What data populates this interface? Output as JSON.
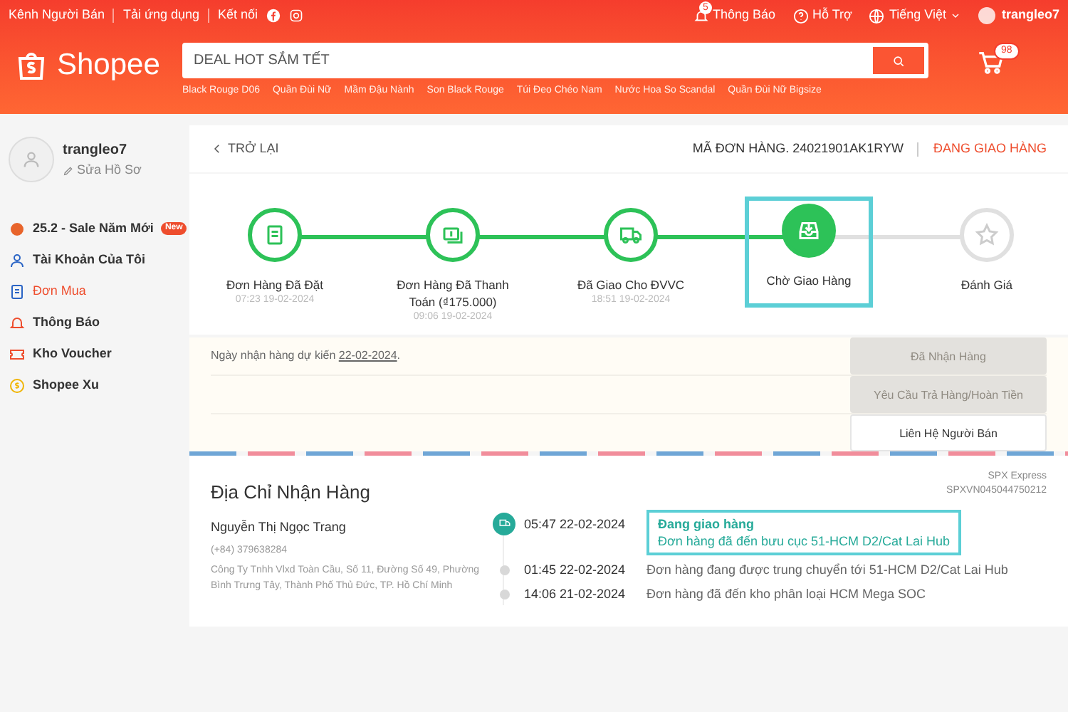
{
  "top_bar": {
    "left_links": [
      "Kênh Người Bán",
      "Tải ứng dụng",
      "Kết nối"
    ],
    "notification_count": "5",
    "right_links": [
      "Thông Báo",
      "Hỗ Trợ",
      "Tiếng Việt"
    ],
    "username": "trangleo7"
  },
  "header": {
    "logo": "Shopee",
    "search": {
      "placeholder": "DEAL HOT SẮM TẾT"
    },
    "suggestions": [
      "Black Rouge D06",
      "Quần Đùi Nữ",
      "Mầm Đậu Nành",
      "Son Black Rouge",
      "Túi Đeo Chéo Nam",
      "Nước Hoa So Scandal",
      "Quần Đùi Nữ Bigsize"
    ],
    "cart_count": "98"
  },
  "sidebar": {
    "username": "trangleo7",
    "edit_profile": "Sửa Hồ Sơ",
    "items": [
      {
        "kind": "promo",
        "label": "25.2 - Sale Năm Mới",
        "badge": "New",
        "selected": false
      },
      {
        "kind": "account",
        "label": "Tài Khoản Của Tôi",
        "selected": false
      },
      {
        "kind": "orders",
        "label": "Đơn Mua",
        "selected": true
      },
      {
        "kind": "notifications",
        "label": "Thông Báo",
        "selected": false
      },
      {
        "kind": "voucher",
        "label": "Kho Voucher",
        "selected": false
      },
      {
        "kind": "coins",
        "label": "Shopee Xu",
        "selected": false
      }
    ]
  },
  "order": {
    "back": "TRỞ LẠI",
    "order_id": "MÃ ĐƠN HÀNG. 24021901AK1RYW",
    "status": "ĐANG GIAO HÀNG",
    "steps": [
      {
        "kind": "placed",
        "label": "Đơn Hàng Đã Đặt",
        "time": "07:23 19-02-2024",
        "completed": true,
        "active": false,
        "highlighted": false
      },
      {
        "kind": "paid",
        "label": "Đơn Hàng Đã Thanh Toán (₫175.000)",
        "time": "09:06 19-02-2024",
        "completed": true,
        "active": false,
        "highlighted": false
      },
      {
        "kind": "shipped",
        "label": "Đã Giao Cho ĐVVC",
        "time": "18:51 19-02-2024",
        "completed": true,
        "active": false,
        "highlighted": false
      },
      {
        "kind": "waiting",
        "label": "Chờ Giao Hàng",
        "completed": false,
        "active": true,
        "highlighted": true
      },
      {
        "kind": "review",
        "label": "Đánh Giá",
        "completed": false,
        "active": false,
        "highlighted": false
      }
    ],
    "expected": {
      "text": "Ngày nhận hàng dự kiến",
      "date": "22-02-2024",
      "end": "."
    },
    "buttons": [
      {
        "label": "Đã Nhận Hàng",
        "disabled": true
      },
      {
        "label": "Yêu Cầu Trả Hàng/Hoàn Tiền",
        "disabled": true
      },
      {
        "label": "Liên Hệ Người Bán",
        "disabled": false
      }
    ]
  },
  "address": {
    "title": "Địa Chỉ Nhận Hàng",
    "carrier": "SPX Express",
    "tracking_number": "SPXVN045044750212",
    "name": "Nguyễn Thị Ngọc Trang",
    "phone": "(+84) 379638284",
    "street": "Công Ty Tnhh Vlxd Toàn Cầu, Số 11, Đường Số 49, Phường Bình Trưng Tây, Thành Phố Thủ Đức, TP. Hồ Chí Minh"
  },
  "tracking": [
    {
      "time": "05:47 22-02-2024",
      "title": "Đang giao hàng",
      "text": "Đơn hàng đã đến bưu cục 51-HCM D2/Cat Lai Hub",
      "current": true,
      "highlighted": true
    },
    {
      "time": "01:45 22-02-2024",
      "text": "Đơn hàng đang được trung chuyển tới 51-HCM D2/Cat Lai Hub",
      "current": false,
      "highlighted": false
    },
    {
      "time": "14:06 21-02-2024",
      "text": "Đơn hàng đã đến kho phân loại HCM Mega SOC",
      "current": false,
      "highlighted": false
    }
  ]
}
